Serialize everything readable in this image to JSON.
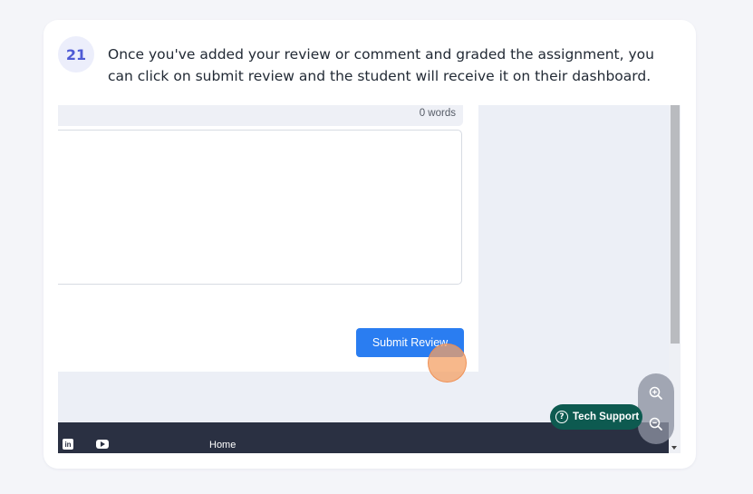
{
  "step": {
    "number": "21",
    "instruction": "Once you've added your review or comment and graded the assignment, you can click on submit review and the student will receive it on their dashboard."
  },
  "screenshot": {
    "word_count": "0 words",
    "submit_label": "Submit Review",
    "tech_support_label": "Tech Support",
    "footer": {
      "home_link": "Home",
      "social_icons": [
        "linkedin-icon",
        "youtube-icon"
      ]
    },
    "zoom_controls": [
      "zoom-in-icon",
      "zoom-out-icon"
    ]
  },
  "colors": {
    "badge_background": "#eceefb",
    "badge_text": "#4f5bd5",
    "submit_button": "#2a7df1",
    "footer_background": "#2a3042",
    "tech_support_background": "#0d5a50",
    "click_indicator": "#f4a064"
  }
}
